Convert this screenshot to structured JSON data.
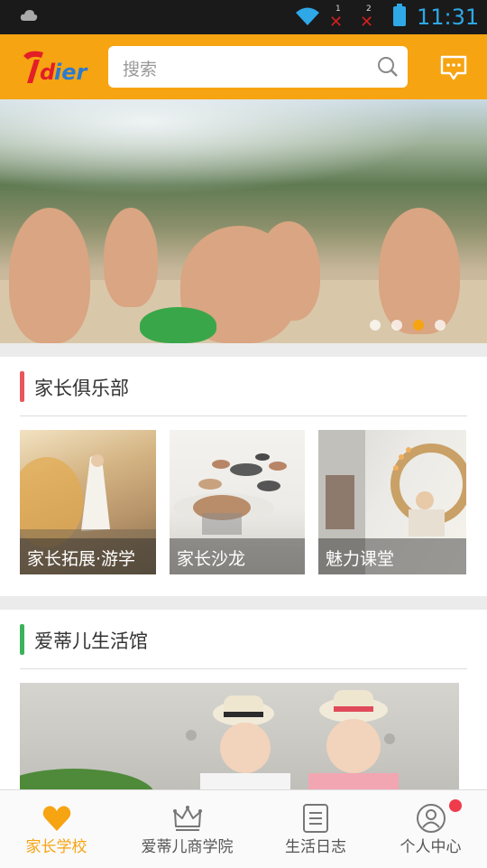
{
  "status_bar": {
    "time": "11:31",
    "sim1": "1",
    "sim2": "2"
  },
  "header": {
    "logo_text": "idier",
    "search_placeholder": "搜索"
  },
  "banner": {
    "dot_count": 4,
    "active_dot": 3
  },
  "section_club": {
    "title": "家长俱乐部",
    "accent": "#e8575a",
    "tiles": [
      {
        "caption": "家长拓展·游学"
      },
      {
        "caption": "家长沙龙"
      },
      {
        "caption": "魅力课堂"
      }
    ]
  },
  "section_life": {
    "title": "爱蒂儿生活馆",
    "accent": "#3cb35a"
  },
  "tabbar": {
    "active_color": "#f7a412",
    "tabs": [
      {
        "label": "家长学校",
        "icon": "heart-icon"
      },
      {
        "label": "爱蒂儿商学院",
        "icon": "crown-icon"
      },
      {
        "label": "生活日志",
        "icon": "journal-icon"
      },
      {
        "label": "个人中心",
        "icon": "user-icon"
      }
    ]
  }
}
